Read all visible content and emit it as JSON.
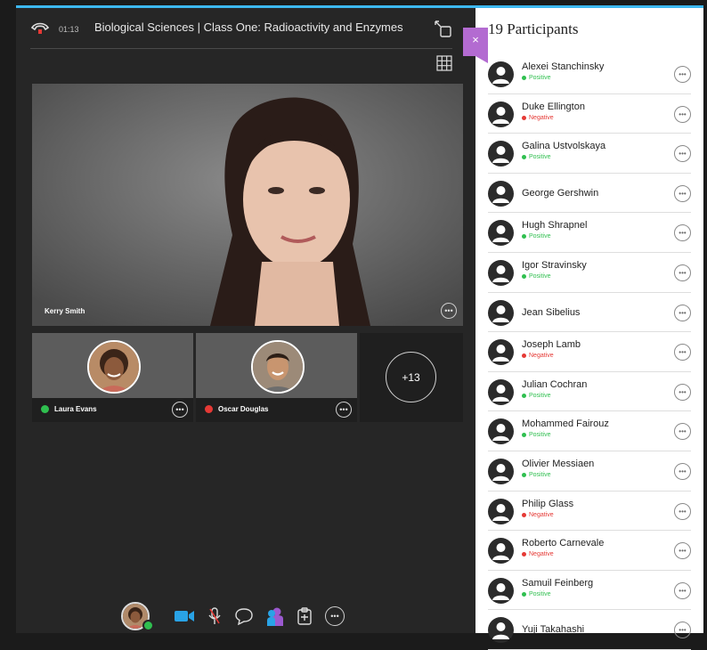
{
  "colors": {
    "accent": "#3db8f0",
    "close_tab": "#b36bd1",
    "positive": "#2fbf4f",
    "negative": "#e53935",
    "camera": "#29a3e6",
    "share": "#9b59d0"
  },
  "header": {
    "timer": "01:13",
    "title": "Biological Sciences | Class One: Radioactivity and Enzymes"
  },
  "main_video": {
    "name": "Kerry Smith"
  },
  "thumbnails": [
    {
      "name": "Laura Evans",
      "status_color": "#2fbf4f"
    },
    {
      "name": "Oscar Douglas",
      "status_color": "#e53935"
    }
  ],
  "more_count": "+13",
  "panel": {
    "title": "19 Participants",
    "close_label": "×",
    "participants": [
      {
        "name": "Alexei Stanchinsky",
        "status": "Positive",
        "kind": "positive"
      },
      {
        "name": "Duke Ellington",
        "status": "Negative",
        "kind": "negative"
      },
      {
        "name": "Galina Ustvolskaya",
        "status": "Positive",
        "kind": "positive"
      },
      {
        "name": "George Gershwin",
        "status": "",
        "kind": "none"
      },
      {
        "name": "Hugh Shrapnel",
        "status": "Positive",
        "kind": "positive"
      },
      {
        "name": "Igor Stravinsky",
        "status": "Positive",
        "kind": "positive"
      },
      {
        "name": "Jean Sibelius",
        "status": "",
        "kind": "none"
      },
      {
        "name": "Joseph Lamb",
        "status": "Negative",
        "kind": "negative"
      },
      {
        "name": "Julian Cochran",
        "status": "Positive",
        "kind": "positive"
      },
      {
        "name": "Mohammed Fairouz",
        "status": "Positive",
        "kind": "positive"
      },
      {
        "name": "Olivier Messiaen",
        "status": "Positive",
        "kind": "positive"
      },
      {
        "name": "Philip Glass",
        "status": "Negative",
        "kind": "negative"
      },
      {
        "name": "Roberto Carnevale",
        "status": "Negative",
        "kind": "negative"
      },
      {
        "name": "Samuil Feinberg",
        "status": "Positive",
        "kind": "positive"
      },
      {
        "name": "Yuji Takahashi",
        "status": "",
        "kind": "none"
      }
    ]
  },
  "toolbar": {
    "icons": [
      "my-status-avatar",
      "camera-icon",
      "microphone-icon",
      "chat-icon",
      "share-content-icon",
      "clipboard-icon",
      "more-icon"
    ]
  }
}
